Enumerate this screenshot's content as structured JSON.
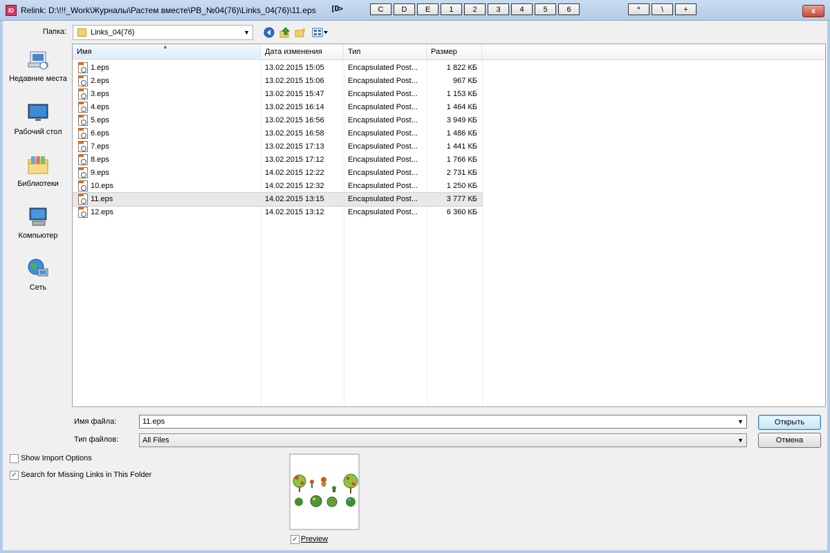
{
  "window": {
    "app_icon": "ID",
    "title": "Relink: D:\\!!!_Work\\Журналы\\Растем вместе\\РВ_№04(76)\\Links_04(76)\\11.eps",
    "id_mark": "[D>",
    "quick_buttons": [
      "C",
      "D",
      "E",
      "1",
      "2",
      "3",
      "4",
      "5",
      "6"
    ],
    "extra_buttons": [
      "*",
      "\\",
      "+"
    ],
    "close_label": "x"
  },
  "folder_bar": {
    "label": "Папка:",
    "current_folder": "Links_04(76)"
  },
  "places": [
    {
      "label": "Недавние места",
      "icon": "recent-places-icon"
    },
    {
      "label": "Рабочий стол",
      "icon": "desktop-icon"
    },
    {
      "label": "Библиотеки",
      "icon": "libraries-icon"
    },
    {
      "label": "Компьютер",
      "icon": "computer-icon"
    },
    {
      "label": "Сеть",
      "icon": "network-icon"
    }
  ],
  "columns": {
    "name": "Имя",
    "date": "Дата изменения",
    "type": "Тип",
    "size": "Размер"
  },
  "files": [
    {
      "name": "1.eps",
      "date": "13.02.2015 15:05",
      "type": "Encapsulated Post...",
      "size": "1 822 КБ"
    },
    {
      "name": "2.eps",
      "date": "13.02.2015 15:06",
      "type": "Encapsulated Post...",
      "size": "967 КБ"
    },
    {
      "name": "3.eps",
      "date": "13.02.2015 15:47",
      "type": "Encapsulated Post...",
      "size": "1 153 КБ"
    },
    {
      "name": "4.eps",
      "date": "13.02.2015 16:14",
      "type": "Encapsulated Post...",
      "size": "1 464 КБ"
    },
    {
      "name": "5.eps",
      "date": "13.02.2015 16:56",
      "type": "Encapsulated Post...",
      "size": "3 949 КБ"
    },
    {
      "name": "6.eps",
      "date": "13.02.2015 16:58",
      "type": "Encapsulated Post...",
      "size": "1 486 КБ"
    },
    {
      "name": "7.eps",
      "date": "13.02.2015 17:13",
      "type": "Encapsulated Post...",
      "size": "1 441 КБ"
    },
    {
      "name": "8.eps",
      "date": "13.02.2015 17:12",
      "type": "Encapsulated Post...",
      "size": "1 766 КБ"
    },
    {
      "name": "9.eps",
      "date": "14.02.2015 12:22",
      "type": "Encapsulated Post...",
      "size": "2 731 КБ"
    },
    {
      "name": "10.eps",
      "date": "14.02.2015 12:32",
      "type": "Encapsulated Post...",
      "size": "1 250 КБ"
    },
    {
      "name": "11.eps",
      "date": "14.02.2015 13:15",
      "type": "Encapsulated Post...",
      "size": "3 777 КБ"
    },
    {
      "name": "12.eps",
      "date": "14.02.2015 13:12",
      "type": "Encapsulated Post...",
      "size": "6 360 КБ"
    }
  ],
  "selected_file": "11.eps",
  "filename": {
    "label": "Имя файла:",
    "value": "11.eps"
  },
  "filetype": {
    "label": "Тип файлов:",
    "value": "All Files"
  },
  "buttons": {
    "open": "Открыть",
    "cancel": "Отмена"
  },
  "options": {
    "show_import": {
      "label": "Show Import Options",
      "checked": false
    },
    "search_missing": {
      "label": "Search for Missing Links in This Folder",
      "checked": true
    },
    "preview": {
      "label": "Preview",
      "checked": true
    }
  }
}
